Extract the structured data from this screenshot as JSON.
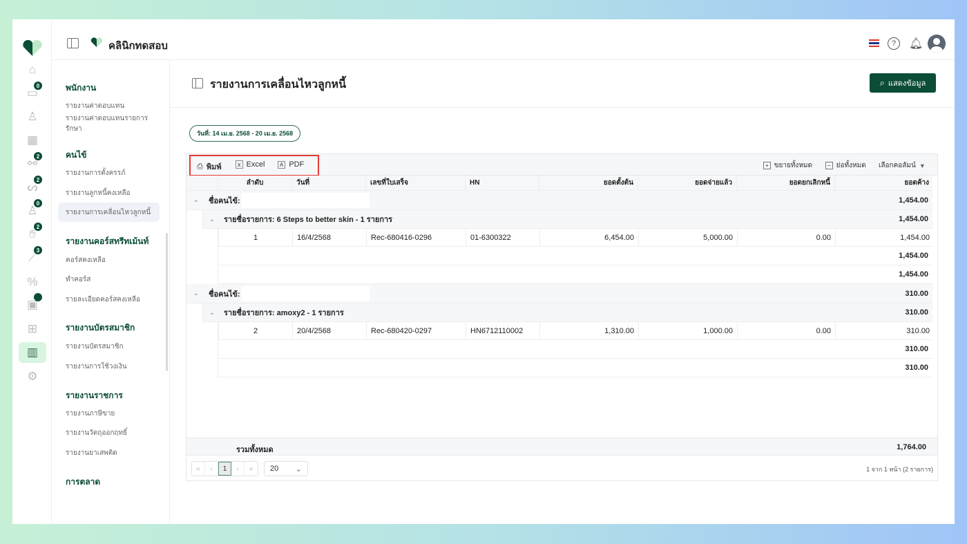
{
  "header": {
    "clinic_name": "คลินิกทดสอบ"
  },
  "rail": {
    "items": [
      {
        "icon": "home-icon"
      },
      {
        "icon": "wallet-icon",
        "badge": "0"
      },
      {
        "icon": "user-icon"
      },
      {
        "icon": "calendar-icon"
      },
      {
        "icon": "dumbbell-icon",
        "badge": "2"
      },
      {
        "icon": "stethoscope-icon",
        "badge": "2"
      },
      {
        "icon": "doctor-icon",
        "badge": "0"
      },
      {
        "icon": "hand-money-icon",
        "badge": "2"
      },
      {
        "icon": "syringe-icon",
        "badge": "3"
      },
      {
        "icon": "percent-icon"
      },
      {
        "icon": "box-icon",
        "badge": ""
      },
      {
        "icon": "grid-icon"
      },
      {
        "icon": "report-chart-icon",
        "active": true
      },
      {
        "icon": "settings-icon"
      }
    ]
  },
  "sidebar": {
    "sections": [
      {
        "title": "พนักงาน",
        "items": [
          "รายงานค่าตอบแทน",
          "รายงานค่าตอบแทนรายการรักษา"
        ]
      },
      {
        "title": "คนไข้",
        "items": [
          "รายงานการตั้งครรภ์",
          "รายงานลูกหนี้คงเหลือ",
          "รายงานการเคลื่อนไหวลูกหนี้"
        ]
      },
      {
        "title": "รายงานคอร์สทรีทเม้นท์",
        "items": [
          "คอร์สคงเหลือ",
          "ทำคอร์ส",
          "รายละเอียดคอร์สคงเหลือ"
        ]
      },
      {
        "title": "รายงานบัตรสมาชิก",
        "items": [
          "รายงานบัตรสมาชิก",
          "รายงานการใช้วงเงิน"
        ]
      },
      {
        "title": "รายงานราชการ",
        "items": [
          "รายงานภาษีขาย",
          "รายงานวัตถุออกฤทธิ์",
          "รายงานยาเสพติด"
        ]
      },
      {
        "title": "การตลาด",
        "items": []
      }
    ],
    "active": "รายงานการเคลื่อนไหวลูกหนี้"
  },
  "page": {
    "title": "รายงานการเคลื่อนไหวลูกหนี้",
    "show_button": "แสดงข้อมูล",
    "date_range": "วันที่: 14 เม.ย. 2568 - 20 เม.ย. 2568"
  },
  "toolbar": {
    "print": "พิมพ์",
    "excel": "Excel",
    "pdf": "PDF",
    "expand_all": "ขยายทั้งหมด",
    "collapse_all": "ย่อทั้งหมด",
    "choose_columns": "เลือกคอลัมน์"
  },
  "table": {
    "columns": [
      "ลำดับ",
      "วันที่",
      "เลขที่ใบเสร็จ",
      "HN",
      "ยอดตั้งต้น",
      "ยอดจ่ายแล้ว",
      "ยอดยกเลิกหนี้",
      "ยอดค้าง"
    ],
    "groups": [
      {
        "label": "ชื่อคนไข้:",
        "total": "1,454.00",
        "sub": {
          "label": "รายชื่อรายการ: 6 Steps to better skin - 1 รายการ",
          "total": "1,454.00",
          "row": [
            "1",
            "16/4/2568",
            "Rec-680416-0296",
            "01-6300322",
            "6,454.00",
            "5,000.00",
            "0.00",
            "1,454.00"
          ],
          "subtotal": "1,454.00",
          "grouptotal": "1,454.00"
        }
      },
      {
        "label": "ชื่อคนไข้:",
        "total": "310.00",
        "sub": {
          "label": "รายชื่อรายการ: amoxy2 - 1 รายการ",
          "total": "310.00",
          "row": [
            "2",
            "20/4/2568",
            "Rec-680420-0297",
            "HN6712110002",
            "1,310.00",
            "1,000.00",
            "0.00",
            "310.00"
          ],
          "subtotal": "310.00",
          "grouptotal": "310.00"
        }
      }
    ],
    "footer_label": "รวมทั้งหมด",
    "footer_total": "1,764.00"
  },
  "pagination": {
    "first": "«",
    "prev": "‹",
    "current": "1",
    "next": "›",
    "last": "»",
    "page_size": "20",
    "summary": "1 จาก 1 หน้า (2 รายการ)"
  },
  "colors": {
    "brand": "#0b4d36",
    "highlight": "#e53935"
  }
}
